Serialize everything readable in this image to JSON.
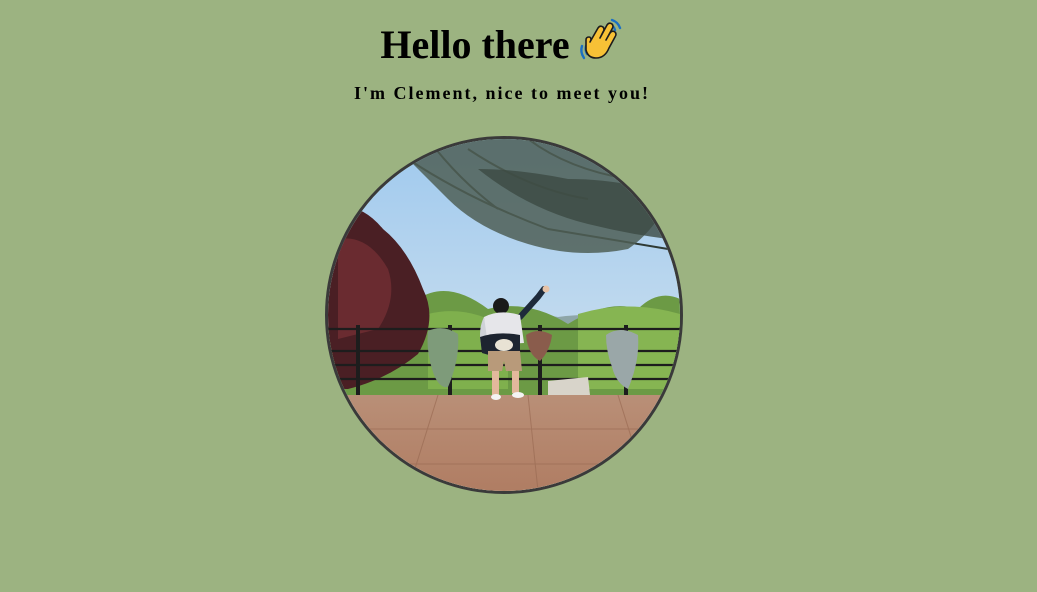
{
  "header": {
    "greeting": "Hello there",
    "wave_icon": "waving-hand-icon",
    "intro": "I'm Clement, nice to meet you!"
  },
  "photo": {
    "subject": "profile-photo"
  },
  "colors": {
    "background": "#9cb381",
    "photo_border": "#3a3a3a"
  }
}
